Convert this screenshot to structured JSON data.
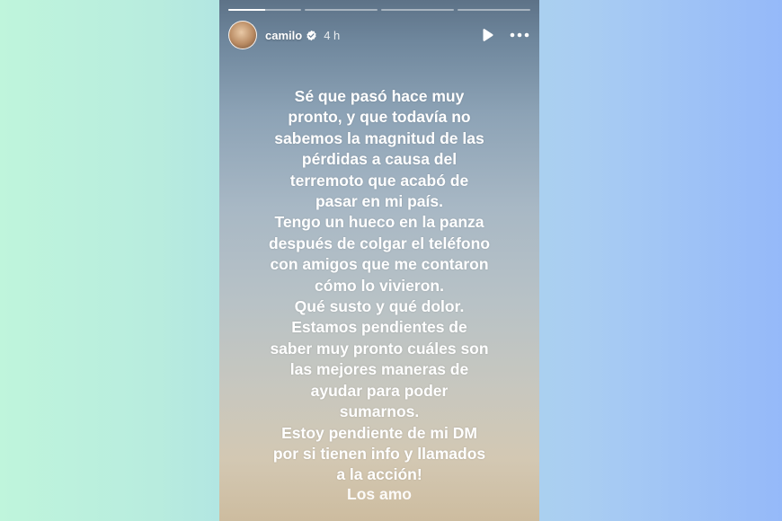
{
  "story": {
    "progress_segments": [
      0.5,
      0,
      0,
      0
    ],
    "user": {
      "name": "camilo",
      "verified": true,
      "time_ago": "4 h"
    },
    "controls": {
      "play_icon": "play-icon",
      "more_icon": "more-options-icon"
    },
    "message_lines": [
      "Sé que pasó hace muy",
      "pronto, y que todavía no",
      "sabemos la magnitud de las",
      "pérdidas a causa del",
      "terremoto que acabó de",
      "pasar en mi país.",
      "Tengo un hueco en la panza",
      "después de colgar el teléfono",
      "con amigos que me contaron",
      "cómo lo vivieron.",
      "Qué susto y qué dolor.",
      "Estamos pendientes de",
      "saber muy pronto cuáles son",
      "las mejores maneras de",
      "ayudar para poder",
      "sumarnos.",
      "Estoy pendiente de mi DM",
      "por si tienen info y llamados",
      "a la acción!"
    ],
    "signoff": "Los amo"
  },
  "colors": {
    "bg_left": "#bff5dc",
    "bg_right": "#95b9f9",
    "sky_top": "#5d7287",
    "sky_bottom": "#cdbc9f",
    "verified_badge": "#ffffff"
  }
}
